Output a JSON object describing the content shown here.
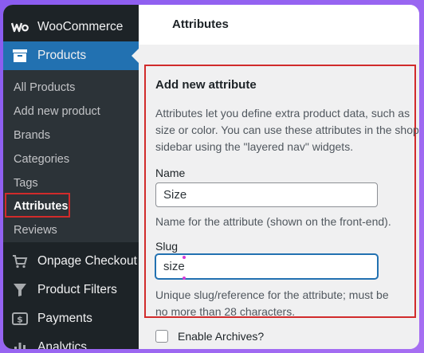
{
  "sidebar": {
    "brand": "WooCommerce",
    "products": "Products",
    "sub_items": [
      "All Products",
      "Add new product",
      "Brands",
      "Categories",
      "Tags",
      "Attributes",
      "Reviews"
    ],
    "current_sub": "Attributes",
    "menu": [
      "Onpage Checkout",
      "Product Filters",
      "Payments",
      "Analytics"
    ]
  },
  "header": {
    "title": "Attributes"
  },
  "form": {
    "heading": "Add new attribute",
    "description_lines": [
      "Attributes let you define extra product data, such as",
      "size or color. You can use these attributes in the shop",
      "sidebar using the \"layered nav\" widgets."
    ],
    "name_label": "Name",
    "name_value": "Size",
    "name_help": "Name for the attribute (shown on the front-end).",
    "slug_label": "Slug",
    "slug_value": "size",
    "slug_help_lines": [
      "Unique slug/reference for the attribute; must be",
      "no more than 28 characters."
    ],
    "archives_label": "Enable Archives?"
  },
  "colors": {
    "accent": "#2271b1",
    "highlight": "#d12b2b",
    "sidebar": "#1d2327"
  }
}
